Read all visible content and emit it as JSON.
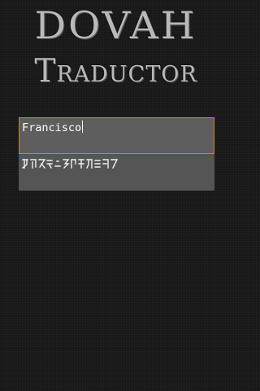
{
  "header": {
    "title": "DOVAH",
    "subtitle": "Traductor"
  },
  "input": {
    "value": "Francisco"
  },
  "output": {
    "script_name": "dragon-script",
    "glyph_count": 12
  },
  "colors": {
    "background": "#1c1c1c",
    "logo_text": "#b9b9b9",
    "input_border": "#c98a1d",
    "input_bg": "#5e5e5e",
    "output_bg": "#555555"
  }
}
